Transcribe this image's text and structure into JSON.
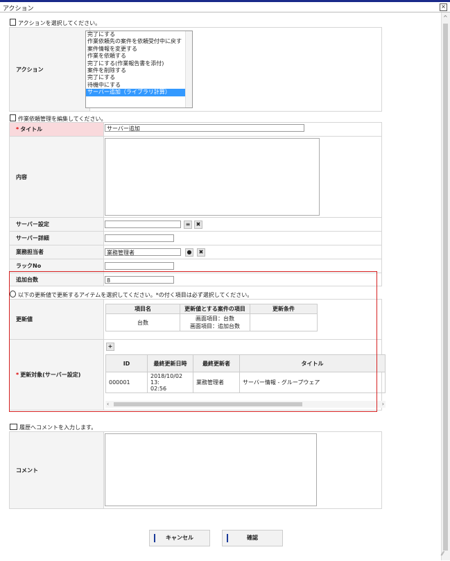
{
  "window": {
    "title": "アクション",
    "close_glyph": "⊠"
  },
  "action_section": {
    "header": "アクションを選択してください。",
    "label": "アクション",
    "options": [
      "完了にする",
      "作業依頼先の案件を依頼受付中に戻す",
      "案件情報を変更する",
      "作業を依頼する",
      "完了にする(作業報告書を添付)",
      "案件を削除する",
      "完了にする",
      "待機中にする",
      "サーバー追加（ライブラリ計算）"
    ],
    "selected_index": 8
  },
  "edit_section": {
    "header": "作業依頼管理を編集してください。",
    "title_label": "タイトル",
    "title_value": "サーバー追加",
    "content_label": "内容",
    "server_setting_label": "サーバー設定",
    "server_detail_label": "サーバー詳細",
    "owner_label": "業務担当者",
    "owner_value": "業務管理者",
    "rack_label": "ラックNo",
    "add_count_label": "追加台数",
    "add_count_value": "8"
  },
  "update_section": {
    "header": "以下の更新値で更新するアイテムを選択してください。*の付く項目は必ず選択してください。",
    "update_value_label": "更新値",
    "update_table": {
      "headers": [
        "項目名",
        "更新値とする案件の項目",
        "更新条件"
      ],
      "row": {
        "item": "台数",
        "value_line1": "画面項目：台数",
        "value_line2": "画面項目：追加台数",
        "condition": ""
      }
    },
    "target_label": "更新対象(サーバー設定)",
    "add_button": "+",
    "target_table": {
      "headers": [
        "ID",
        "最終更新日時",
        "最終更新者",
        "タイトル"
      ],
      "row": {
        "id": "000001",
        "updated_line1": "2018/10/02 13:",
        "updated_line2": "02:56",
        "updater": "業務管理者",
        "title": "サーバー情報 - グループウェア"
      }
    }
  },
  "comment_section": {
    "header": "履歴へコメントを入力します。",
    "label": "コメント"
  },
  "footer": {
    "cancel_label": "キャンセル",
    "confirm_label": "確認"
  },
  "colors": {
    "required_bg": "#f9d9dc",
    "highlight_border": "#d62020",
    "selected_option": "#3399ff",
    "button_accent": "#1a3a9a"
  }
}
